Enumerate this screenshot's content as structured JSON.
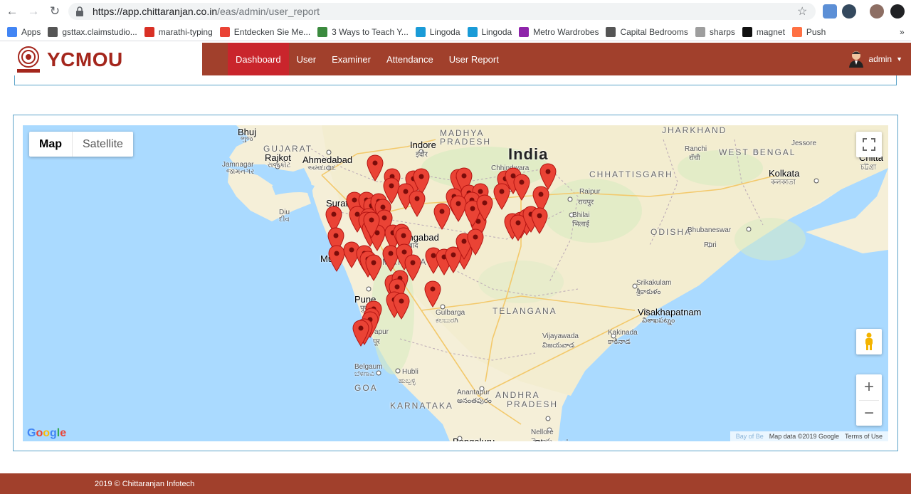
{
  "browser": {
    "url_host": "https://app.chittaranjan.co.in",
    "url_path": "/eas/admin/user_report",
    "bookmarks": [
      {
        "label": "Apps",
        "color": "#4285f4"
      },
      {
        "label": "gsttax.claimstudio...",
        "color": "#555555"
      },
      {
        "label": "marathi-typing",
        "color": "#d93025"
      },
      {
        "label": "Entdecken Sie Me...",
        "color": "#ea4335"
      },
      {
        "label": "3 Ways to Teach Y...",
        "color": "#3b8a3e"
      },
      {
        "label": "Lingoda",
        "color": "#1a9bd7"
      },
      {
        "label": "Lingoda",
        "color": "#1a9bd7"
      },
      {
        "label": "Metro Wardrobes",
        "color": "#8e24aa"
      },
      {
        "label": "Capital Bedrooms",
        "color": "#555555"
      },
      {
        "label": "sharps",
        "color": "#9e9e9e"
      },
      {
        "label": "magnet",
        "color": "#111111"
      },
      {
        "label": "Push",
        "color": "#ff7043"
      }
    ],
    "more": "»"
  },
  "site": {
    "logo_text": "YCMOU",
    "nav": [
      "Dashboard",
      "User",
      "Examiner",
      "Attendance",
      "User Report"
    ],
    "user": "admin",
    "brand_color": "#a1402c",
    "active_color": "#c9252c"
  },
  "map": {
    "type_map": "Map",
    "type_satellite": "Satellite",
    "zoom_in": "+",
    "zoom_out": "−",
    "google": "Google",
    "attribution": "Map data ©2019 Google",
    "terms": "Terms of Use",
    "bay": "Bay of Be",
    "labels": [
      {
        "t": "Bhuj",
        "c": "big"
      },
      {
        "t": "ભુજ",
        "c": "sub"
      },
      {
        "t": "GUJARAT",
        "c": "state"
      },
      {
        "t": "Rajkot",
        "c": "big"
      },
      {
        "t": "રાજકોટ",
        "c": "sub"
      },
      {
        "t": "Jamnagar",
        "c": "sub"
      },
      {
        "t": "જામનગર",
        "c": "sub"
      },
      {
        "t": "Ahmedabad",
        "c": "big"
      },
      {
        "t": "અમદાવાદ",
        "c": "sub"
      },
      {
        "t": "MADHYA",
        "c": "state"
      },
      {
        "t": "PRADESH",
        "c": "state"
      },
      {
        "t": "Indore",
        "c": "big"
      },
      {
        "t": "इंदौर",
        "c": "sub"
      },
      {
        "t": "India",
        "c": "country"
      },
      {
        "t": "Chhindwara",
        "c": "sub"
      },
      {
        "t": "छिंदवाड़ा",
        "c": "sub"
      },
      {
        "t": "JHARKHAND",
        "c": "state"
      },
      {
        "t": "Ranchi",
        "c": "sub"
      },
      {
        "t": "राँची",
        "c": "sub"
      },
      {
        "t": "WEST BENGAL",
        "c": "state"
      },
      {
        "t": "Jessore",
        "c": "sub"
      },
      {
        "t": "Chitta",
        "c": "big"
      },
      {
        "t": "চট্টগ্রা",
        "c": "sub"
      },
      {
        "t": "Kolkata",
        "c": "big"
      },
      {
        "t": "কলকাতা",
        "c": "sub"
      },
      {
        "t": "CHHATTISGARH",
        "c": "state"
      },
      {
        "t": "Raipur",
        "c": "sub"
      },
      {
        "t": "रायपुर",
        "c": "sub"
      },
      {
        "t": "Bhilai",
        "c": "sub"
      },
      {
        "t": "भिलाई",
        "c": "sub"
      },
      {
        "t": "Surat",
        "c": "big"
      },
      {
        "t": "Diu",
        "c": "sub"
      },
      {
        "t": "દીવ",
        "c": "sub"
      },
      {
        "t": "Aurangabad",
        "c": "big"
      },
      {
        "t": "बाद",
        "c": "sub"
      },
      {
        "t": "ODISHA",
        "c": "state"
      },
      {
        "t": "Bhubaneswar",
        "c": "sub"
      },
      {
        "t": "Puri",
        "c": "sub"
      },
      {
        "t": "Mu",
        "c": "big"
      },
      {
        "t": "MAHARASHTRA",
        "c": "state"
      },
      {
        "t": "Pune",
        "c": "big"
      },
      {
        "t": "पुणे",
        "c": "sub"
      },
      {
        "t": "Srikakulam",
        "c": "sub"
      },
      {
        "t": "శ్రీకాకుళం",
        "c": "sub"
      },
      {
        "t": "Gulbarga",
        "c": "sub"
      },
      {
        "t": "ಕಲಬುರಗಿ",
        "c": "sub"
      },
      {
        "t": "TELANGANA",
        "c": "state"
      },
      {
        "t": "Visakhapatnam",
        "c": "big"
      },
      {
        "t": "విశాఖపట్నం",
        "c": "sub"
      },
      {
        "t": "apur",
        "c": "sub"
      },
      {
        "t": "पूर",
        "c": "sub"
      },
      {
        "t": "Vijayawada",
        "c": "sub"
      },
      {
        "t": "విజయవాడ",
        "c": "sub"
      },
      {
        "t": "Kakinada",
        "c": "sub"
      },
      {
        "t": "కాకినాడ",
        "c": "sub"
      },
      {
        "t": "Belgaum",
        "c": "sub"
      },
      {
        "t": "ಬೆಳಗಾವಿ",
        "c": "sub"
      },
      {
        "t": "Hubli",
        "c": "sub"
      },
      {
        "t": "ಹುಬ್ಬಳ್ಳಿ",
        "c": "sub"
      },
      {
        "t": "GOA",
        "c": "state"
      },
      {
        "t": "Anantapur",
        "c": "sub"
      },
      {
        "t": "అనంతపురం",
        "c": "sub"
      },
      {
        "t": "ANDHRA",
        "c": "state"
      },
      {
        "t": "PRADESH",
        "c": "state"
      },
      {
        "t": "KARNATAKA",
        "c": "state"
      },
      {
        "t": "Nellore",
        "c": "sub"
      },
      {
        "t": "నెల్లూరు",
        "c": "sub"
      },
      {
        "t": "Bengaluru",
        "c": "big"
      },
      {
        "t": "Chennai",
        "c": "big"
      }
    ]
  },
  "footer": {
    "text": "2019 © Chittaranjan Infotech"
  }
}
